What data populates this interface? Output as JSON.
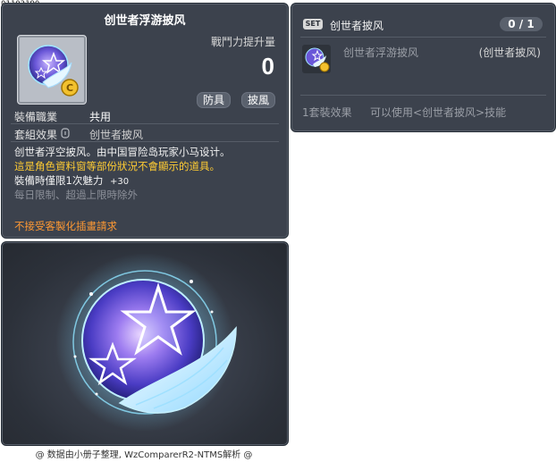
{
  "item_id": "01103190",
  "tooltip": {
    "title": "创世者浮游披风",
    "stat_label": "戰鬥力提升量",
    "stat_value": "0",
    "tags": [
      "防具",
      "披風"
    ],
    "job_label": "裝備職業",
    "job_value": "共用",
    "set_label": "套組效果",
    "set_value": "创世者披风",
    "desc_lines": [
      {
        "text": "创世者浮空披风。由中国冒险岛玩家小马设计。",
        "color": "white"
      },
      {
        "text": "這是角色資料窗等部份狀況不會顯示的道具。",
        "color": "yellow"
      },
      {
        "text": "裝備時僅限1次魅力",
        "color": "white",
        "suffix": "+30"
      },
      {
        "text": "每日限制、超過上限時除外",
        "color": "gray"
      }
    ],
    "warning": "不接受客製化插畫請求"
  },
  "set_panel": {
    "badge": "SET",
    "name": "创世者披风",
    "count": "0 / 1",
    "item_name": "创世者浮游披风",
    "item_sub": "(创世者披风)",
    "effect_label": "1套裝效果",
    "effect_desc": "可以使用<创世者披风>技能"
  },
  "footer": "@ 数据由小册子整理, WzComparerR2-NTMS解析 @"
}
